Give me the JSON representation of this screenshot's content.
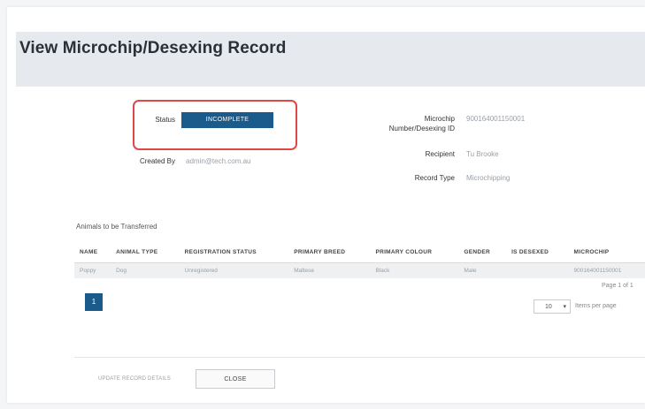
{
  "page": {
    "title": "View Microchip/Desexing Record"
  },
  "details": {
    "status_label": "Status",
    "status_value": "INCOMPLETE",
    "created_by_label": "Created By",
    "created_by_value": "admin@tech.com.au",
    "microchip_label_1": "Microchip",
    "microchip_label_2": "Number/Desexing ID",
    "microchip_value": "900164001150001",
    "recipient_label": "Recipient",
    "recipient_value": "Tu Brooke",
    "record_type_label": "Record Type",
    "record_type_value": "Microchipping"
  },
  "animals": {
    "title": "Animals to be Transferred",
    "columns": [
      "NAME",
      "ANIMAL TYPE",
      "REGISTRATION STATUS",
      "PRIMARY BREED",
      "PRIMARY COLOUR",
      "GENDER",
      "IS DESEXED",
      "MICROCHIP"
    ],
    "rows": [
      [
        "Poppy",
        "Dog",
        "Unregistered",
        "Maltese",
        "Black",
        "Male",
        "",
        "900164001150001"
      ]
    ]
  },
  "pagination": {
    "current_page": "1",
    "page_info": "Page 1 of 1",
    "per_page_value": "10",
    "per_page_label": "Items per page"
  },
  "actions": {
    "update_label": "UPDATE RECORD DETAILS",
    "close_label": "CLOSE"
  },
  "colors": {
    "accent": "#1a5b8c",
    "highlight_border": "#e04848",
    "header_bg": "#e6e9ed"
  }
}
